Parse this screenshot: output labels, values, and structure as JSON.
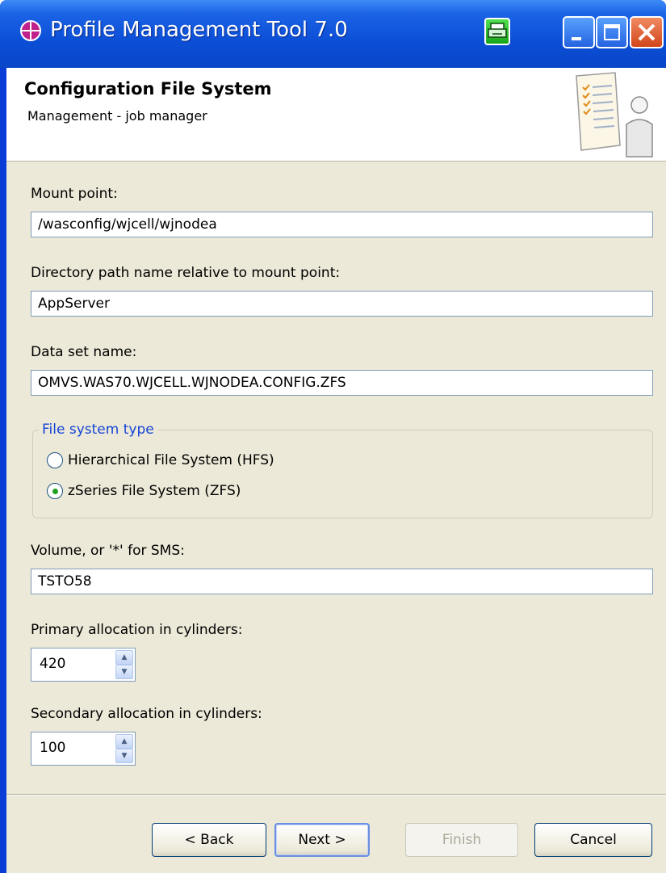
{
  "window": {
    "title": "Profile Management Tool 7.0",
    "accent": "#0a46c8",
    "close_color": "#d2451a"
  },
  "header": {
    "title": "Configuration File System",
    "subtitle": "Management - job manager",
    "graphic_icon": "checklist-person-icon"
  },
  "form": {
    "mount_point": {
      "label": "Mount point:",
      "value": "/wasconfig/wjcell/wjnodea"
    },
    "directory_path": {
      "label": "Directory path name relative to mount point:",
      "value": "AppServer"
    },
    "data_set_name": {
      "label": "Data set name:",
      "value": "OMVS.WAS70.WJCELL.WJNODEA.CONFIG.ZFS"
    },
    "file_system_type": {
      "legend": "File system type",
      "options": [
        {
          "label": "Hierarchical File System (HFS)",
          "checked": false
        },
        {
          "label": "zSeries File System (ZFS)",
          "checked": true
        }
      ]
    },
    "volume": {
      "label": "Volume, or '*' for SMS:",
      "value": "TSTO58"
    },
    "primary_allocation": {
      "label": "Primary allocation in cylinders:",
      "value": "420"
    },
    "secondary_allocation": {
      "label": "Secondary allocation in cylinders:",
      "value": "100"
    }
  },
  "buttons": {
    "back": "< Back",
    "next": "Next >",
    "finish": "Finish",
    "cancel": "Cancel"
  }
}
